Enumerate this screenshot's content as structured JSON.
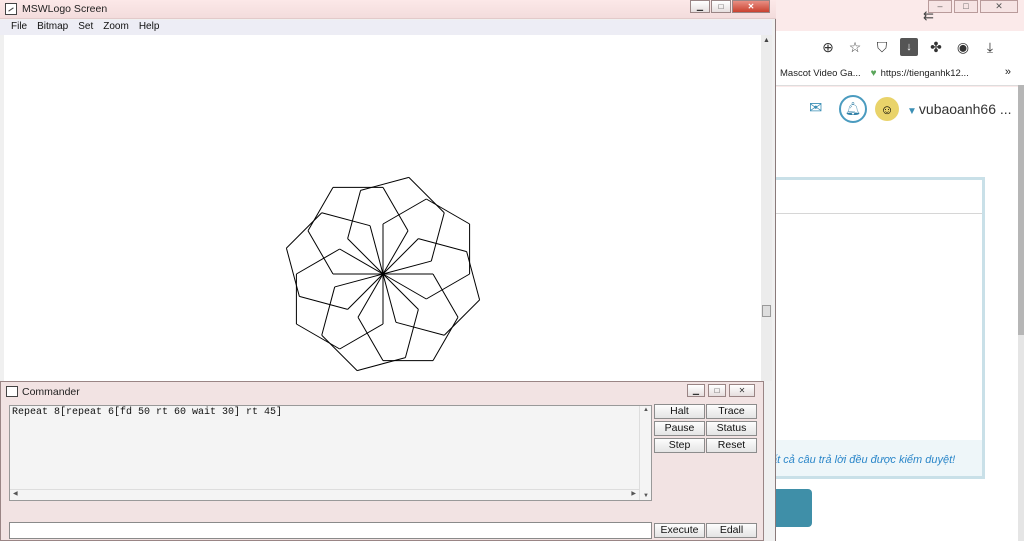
{
  "browser": {
    "back_icon": "back-arrow-icon",
    "toolbar_icons": [
      "zoom-in-icon",
      "star-icon",
      "shield-icon",
      "download-box-icon",
      "puzzle-icon",
      "account-icon",
      "download-icon"
    ],
    "bookmarks": [
      "Mascot Video Ga...",
      "https://tienganhk12..."
    ],
    "more": "»",
    "username": "vubaoanh66 ...",
    "notice": "tất cả câu trả lời đều được kiểm duyệt!"
  },
  "logo_window": {
    "title": "MSWLogo Screen",
    "menu": [
      "File",
      "Bitmap",
      "Set",
      "Zoom",
      "Help"
    ],
    "drawing": {
      "repeats": 8,
      "inner_repeat": 6,
      "forward": 50,
      "turn": 60,
      "outer_turn": 45,
      "stroke": "#000000"
    }
  },
  "commander": {
    "title": "Commander",
    "history_text": "Repeat 8[repeat 6[fd 50 rt 60 wait 30] rt 45]",
    "input_value": "",
    "buttons": {
      "halt": "Halt",
      "trace": "Trace",
      "pause": "Pause",
      "status": "Status",
      "step": "Step",
      "reset": "Reset",
      "execute": "Execute",
      "edall": "Edall"
    }
  },
  "colors": {
    "title_bar": "#f3dcdc",
    "close_button": "#c9412f",
    "accent_teal": "#3f8fa8",
    "link_blue": "#2a86c9"
  }
}
